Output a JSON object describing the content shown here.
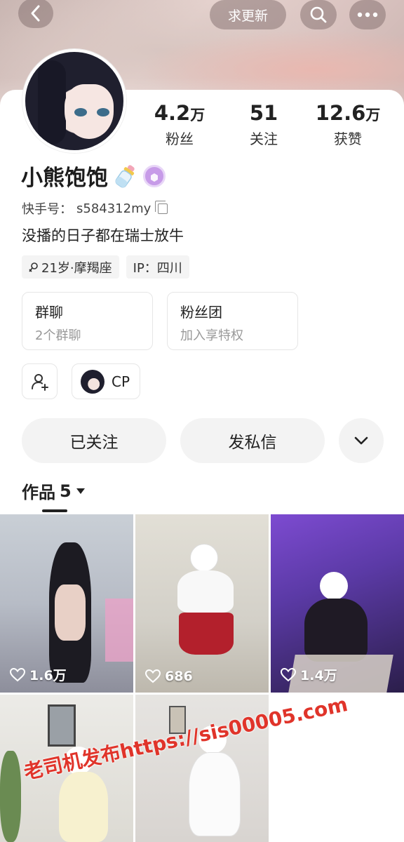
{
  "topbar": {
    "back_icon": "chevron-left-icon",
    "update_label": "求更新",
    "search_icon": "search-icon",
    "more_icon": "more-dots-icon"
  },
  "profile": {
    "stats": [
      {
        "value": "4.2",
        "unit": "万",
        "label": "粉丝"
      },
      {
        "value": "51",
        "unit": "",
        "label": "关注"
      },
      {
        "value": "12.6",
        "unit": "万",
        "label": "获赞"
      }
    ],
    "name": "小熊饱饱",
    "uid_label": "快手号：",
    "uid": "s584312my",
    "bio": "没播的日子都在瑞士放牛",
    "tags": [
      {
        "icon": "gender-female-icon",
        "text": "21岁·摩羯座"
      },
      {
        "icon": "",
        "text": "IP：四川"
      }
    ]
  },
  "groups": [
    {
      "title": "群聊",
      "subtitle": "2个群聊"
    },
    {
      "title": "粉丝团",
      "subtitle": "加入享特权"
    }
  ],
  "cp_label": "CP",
  "actions": {
    "follow_label": "已关注",
    "message_label": "发私信",
    "more_icon": "chevron-down-icon"
  },
  "works": {
    "label": "作品",
    "count": "5"
  },
  "videos": [
    {
      "likes": "1.6万"
    },
    {
      "likes": "686"
    },
    {
      "likes": "1.4万"
    },
    {
      "likes": ""
    },
    {
      "likes": ""
    }
  ],
  "watermark": "老司机发布https://sis00005.com",
  "colors": {
    "watermark": "#e0342a",
    "badge": "#c79be8"
  }
}
